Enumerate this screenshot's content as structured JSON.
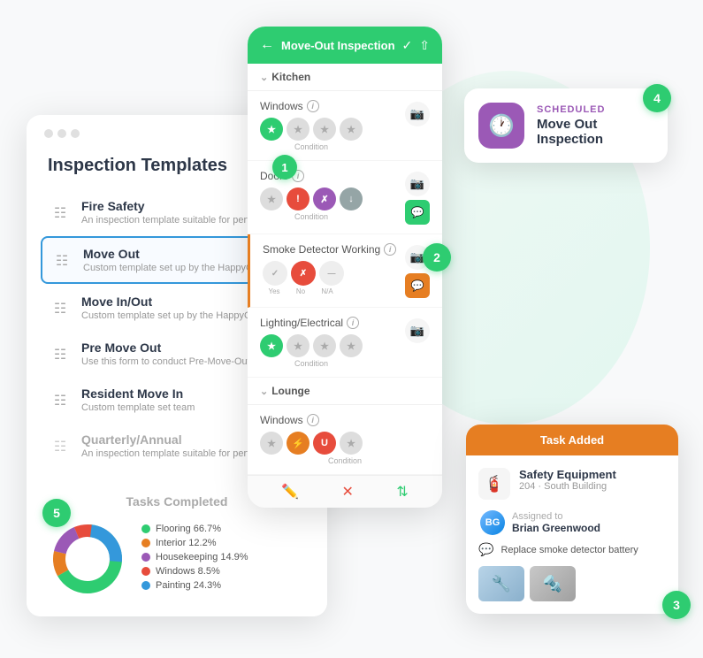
{
  "bg": {
    "color": "#f8f9fa"
  },
  "badges": {
    "b1": "1",
    "b2": "2",
    "b3": "3",
    "b4": "4",
    "b5": "5"
  },
  "desktop_card": {
    "title": "Inspection Templates",
    "templates": [
      {
        "name": "Fire Safety",
        "desc": "An inspection template suitable for performing",
        "active": false
      },
      {
        "name": "Move Out",
        "desc": "Custom template set up by the HappyCo team",
        "active": true
      },
      {
        "name": "Move In/Out",
        "desc": "Custom template set up by the HappyCo team",
        "active": false
      },
      {
        "name": "Pre Move Out",
        "desc": "Use this form to conduct Pre-Move-Out inspec...",
        "active": false
      },
      {
        "name": "Resident Move In",
        "desc": "Custom template set team",
        "active": false
      },
      {
        "name": "Quarterly/Annual",
        "desc": "An inspection template suitable for performing",
        "active": false
      }
    ],
    "tasks": {
      "title": "Tasks Completed",
      "legend": [
        {
          "label": "Flooring",
          "pct": "66.7%",
          "color": "#2ecc71"
        },
        {
          "label": "Interior",
          "pct": "12.2%",
          "color": "#e67e22"
        },
        {
          "label": "Housekeeping",
          "pct": "14.9%",
          "color": "#9b59b6"
        },
        {
          "label": "Windows",
          "pct": "8.5%",
          "color": "#e74c3c"
        },
        {
          "label": "Painting",
          "pct": "24.3%",
          "color": "#3498db"
        }
      ]
    }
  },
  "mobile_card": {
    "header_title": "Move-Out Inspection",
    "sections": [
      {
        "name": "Kitchen",
        "items": [
          {
            "label": "Windows",
            "condition_label": "Condition"
          },
          {
            "label": "Doors",
            "condition_label": "Condition"
          },
          {
            "label": "Smoke Detector Working",
            "labels": [
              "Yes",
              "No",
              "N/A"
            ]
          },
          {
            "label": "Lighting/Electrical",
            "condition_label": "Condition"
          }
        ]
      },
      {
        "name": "Lounge",
        "items": [
          {
            "label": "Windows",
            "condition_label": "Condition"
          }
        ]
      }
    ]
  },
  "scheduled_card": {
    "label": "SCHEDULED",
    "title": "Move Out Inspection"
  },
  "task_card": {
    "header": "Task Added",
    "item_title": "Safety Equipment",
    "item_subtitle": "204 · South Building",
    "assigned_label": "Assigned to",
    "assigned_name": "Brian Greenwood",
    "note_text": "Replace smoke detector battery"
  }
}
